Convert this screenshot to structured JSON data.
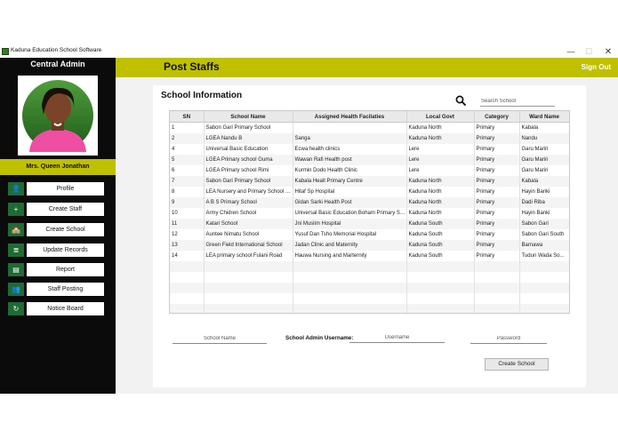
{
  "window": {
    "title": "Kaduna Education School Software",
    "min_symbol": "—",
    "max_symbol": "☐",
    "close_symbol": "✕"
  },
  "sidebar": {
    "header": "Central Admin",
    "user_name": "Mrs.  Queen Jonathan",
    "items": [
      {
        "label": "Profile",
        "icon": "person-icon",
        "glyph": "👤"
      },
      {
        "label": "Create Staff",
        "icon": "plus-icon",
        "glyph": "+"
      },
      {
        "label": "Create School",
        "icon": "school-icon",
        "glyph": "🏫"
      },
      {
        "label": "Update Records",
        "icon": "database-icon",
        "glyph": "≣"
      },
      {
        "label": "Report",
        "icon": "report-icon",
        "glyph": "▤"
      },
      {
        "label": "Staff Posting",
        "icon": "add-user-icon",
        "glyph": "👥"
      },
      {
        "label": "Notice Board",
        "icon": "refresh-icon",
        "glyph": "↻"
      }
    ]
  },
  "header": {
    "title": "Post Staffs",
    "signout": "Sign Out"
  },
  "main": {
    "section_title": "School Information",
    "search": {
      "placeholder": "Search School",
      "icon": "search-icon"
    },
    "table": {
      "columns": [
        "SN",
        "School Name",
        "Assigned Health Facilaties",
        "Local Govt",
        "Category",
        "Ward Name"
      ],
      "rows": [
        [
          "1",
          "Sabon Gari Primary School",
          "",
          "Kaduna North",
          "Primary",
          "Kabala"
        ],
        [
          "2",
          "LGEA Nandu B",
          "Sanga",
          "Kaduna North",
          "Primary",
          "Nandu"
        ],
        [
          "4",
          "Universal Basic Education",
          "Ecwa health clinics",
          "Lere",
          "Primary",
          "Garu Mariri"
        ],
        [
          "5",
          "LGEA  Primary school Guma",
          "Wawan Rafi Health post",
          "Lere",
          "Primary",
          "Garu Mariri"
        ],
        [
          "6",
          "LGEA  Primary school Rimi",
          "Kurmin Dodo Health Clinic",
          "Lere",
          "Primary",
          "Garu Mariri"
        ],
        [
          "7",
          "Sabon Gari Primary School",
          "Kabala Healt Primary Centre",
          "Kaduna North",
          "Primary",
          "Kabala"
        ],
        [
          "8",
          "LEA Nursery and Primary School U...",
          "Hitaf Sp Hospital",
          "Kaduna North",
          "Primary",
          "Hayin Banki"
        ],
        [
          "9",
          "A B S Primary School",
          "Gidan Sarki Health Post",
          "Kaduna North",
          "Primary",
          "Dadi Riba"
        ],
        [
          "10",
          "Army Chidren School",
          "Universal Basic Education Boham Primary Sc...",
          "Kaduna North",
          "Primary",
          "Hayin Banki"
        ],
        [
          "11",
          "Katari School",
          "Jni Muslim Hospital",
          "Kaduna South",
          "Primary",
          "Sabon Gari"
        ],
        [
          "12",
          "Auntee Nimatu  School",
          "Yusuf Dan Tsho Memorial Hospital",
          "Kaduna South",
          "Primary",
          "Sabon Gari South"
        ],
        [
          "13",
          "Green Field International School",
          "Jadan Clinic and Maternity",
          "Kaduna South",
          "Primary",
          "Barnawa"
        ],
        [
          "14",
          "LEA primary school Fulani Road",
          "Hauwa Nursing and Marternity",
          "Kaduna South",
          "Primary",
          "Tudun Wada So..."
        ]
      ]
    },
    "form": {
      "school_name_placeholder": "School Name",
      "admin_label": "School Admin Username:",
      "username_placeholder": "Username",
      "password_placeholder": "Password",
      "create_button": "Create School"
    }
  },
  "colors": {
    "accent": "#bfc000",
    "sidebar_bg": "#0b0b0b",
    "nav_icon_bg": "#1f6b34",
    "avatar_shirt": "#ee4fa3"
  }
}
